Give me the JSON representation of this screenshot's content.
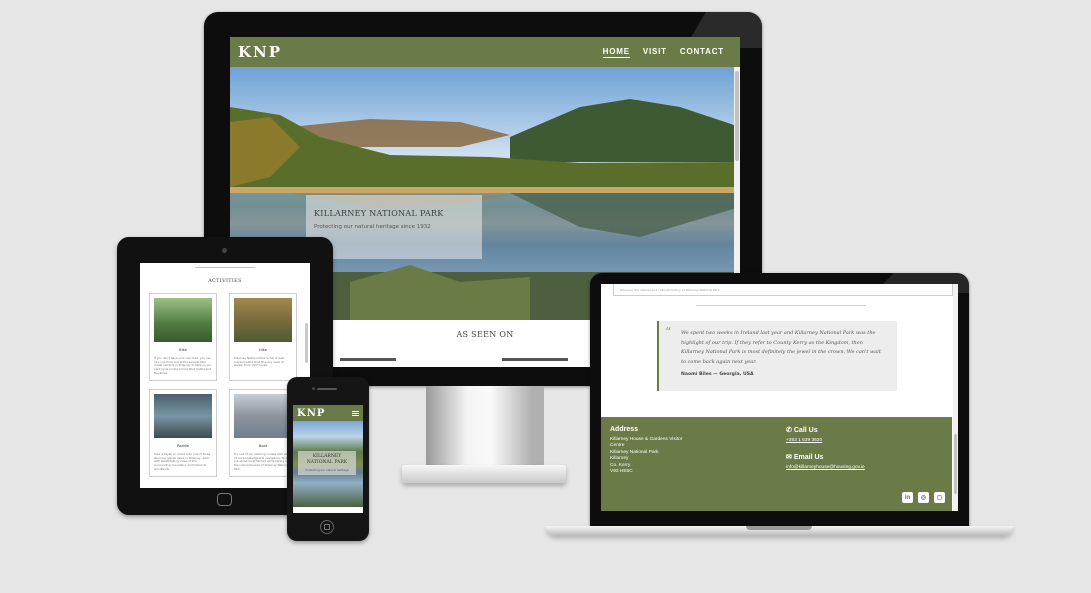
{
  "site": {
    "logo": "KNP",
    "nav": [
      "HOME",
      "VISIT",
      "CONTACT"
    ],
    "accent_color": "#6b7b47"
  },
  "desktop": {
    "hero_title": "KILLARNEY NATIONAL PARK",
    "hero_subtitle": "Protecting our natural heritage since 1932",
    "section_title": "AS SEEN ON"
  },
  "tablet": {
    "section_title": "ACTIVITIES",
    "cards": [
      {
        "title": "Bike",
        "text": "If you don't have your own bike, you can hire one from one of the several bike rental vendors in Killarney to take on our park cycle routes across Ross Castle and Muckross."
      },
      {
        "title": "Hike",
        "text": "Killarney National Park is full of well-marked walks that fit every level of walker from short loops."
      },
      {
        "title": "Paddle",
        "text": "Take a kayak or canoe onto one of three stunning glacial lakes in Killarney, each with breathtaking views of the surrounding mountains and historical woodlands."
      },
      {
        "title": "Boat",
        "text": "Try one of our relaxing cruises with some of our knowledgeable navigators, find out about local folklore while taking in the natural beauty of Killarney National Park."
      }
    ]
  },
  "phone": {
    "hero_title": "KILLARNEY NATIONAL PARK",
    "hero_subtitle": "Protecting our natural heritage"
  },
  "laptop": {
    "prev_text": "Discover the natural and cultural history of Killarney National Park",
    "quote": "We spent two weeks in Ireland last year and Killarney National Park was the highlight of our trip. If they refer to County Kerry as the Kingdom, then Killarney National Park is most definitely the jewel in the crown. We can't wait to come back again next year.",
    "quote_author": "Naomi Biles — Georgia, USA",
    "address_title": "Address",
    "address_lines": [
      "Killarney House & Gardens Visitor",
      "Centre",
      "Killarney National Park",
      "Killarney",
      "Co. Kerry",
      "V93 HE5C"
    ],
    "call_title": "Call Us",
    "phone": "+353 1 539 3620",
    "email_title": "Email Us",
    "email": "info@killarneyhouse@housing.gov.ie",
    "socials": [
      "in",
      "◎",
      "◻"
    ]
  }
}
